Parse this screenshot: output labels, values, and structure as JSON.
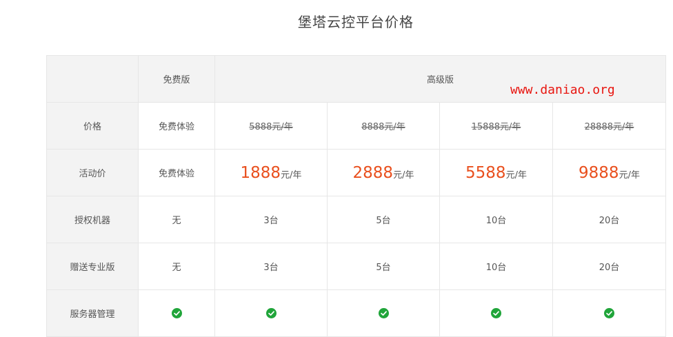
{
  "page": {
    "title": "堡塔云控平台价格",
    "watermark": "www.daniao.org"
  },
  "table": {
    "header": {
      "empty": "",
      "free": "免费版",
      "premium": "高级版"
    },
    "rows": {
      "price": {
        "label": "价格",
        "free": "免费体验",
        "plans": [
          "5888元/年",
          "8888元/年",
          "15888元/年",
          "28888元/年"
        ]
      },
      "promo": {
        "label": "活动价",
        "free": "免费体验",
        "plans": [
          {
            "amount": "1888",
            "unit": "元/年"
          },
          {
            "amount": "2888",
            "unit": "元/年"
          },
          {
            "amount": "5588",
            "unit": "元/年"
          },
          {
            "amount": "9888",
            "unit": "元/年"
          }
        ]
      },
      "machines": {
        "label": "授权机器",
        "free": "无",
        "plans": [
          "3台",
          "5台",
          "10台",
          "20台"
        ]
      },
      "pro_gift": {
        "label": "赠送专业版",
        "free": "无",
        "plans": [
          "3台",
          "5台",
          "10台",
          "20台"
        ]
      },
      "server_mgmt": {
        "label": "服务器管理",
        "free_icon": "check-circle-icon",
        "plan_icons": [
          "check-circle-icon",
          "check-circle-icon",
          "check-circle-icon",
          "check-circle-icon"
        ]
      }
    }
  },
  "colors": {
    "promo_price": "#e94f1d",
    "check": "#20a53a",
    "watermark": "#e8150f",
    "header_bg": "#f3f3f3",
    "border": "#e6e6e6"
  }
}
